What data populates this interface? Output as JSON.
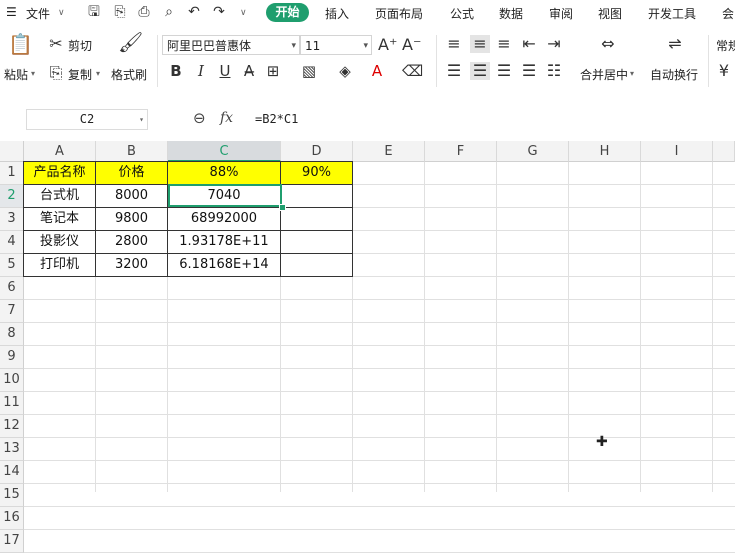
{
  "menubar": {
    "file_label": "文件",
    "tabs": [
      "开始",
      "插入",
      "页面布局",
      "公式",
      "数据",
      "审阅",
      "视图",
      "开发工具",
      "会"
    ],
    "active_tab": "开始",
    "accent_color": "#1f9e6e"
  },
  "ribbon": {
    "paste": "粘贴",
    "cut": "剪切",
    "copy": "复制",
    "format_painter": "格式刷",
    "font_name": "阿里巴巴普惠体",
    "font_size": "11",
    "merge_center": "合并居中",
    "wrap_text": "自动换行",
    "number_format": "常规"
  },
  "formula_bar": {
    "name_box": "C2",
    "fx_label": "fx",
    "formula": "=B2*C1"
  },
  "sheet": {
    "columns": [
      "A",
      "B",
      "C",
      "D",
      "E",
      "F",
      "G",
      "H",
      "I"
    ],
    "rows": [
      "1",
      "2",
      "3",
      "4",
      "5",
      "6",
      "7",
      "8",
      "9",
      "10",
      "11",
      "12",
      "13",
      "14",
      "15",
      "16",
      "17"
    ],
    "selected_column": "C",
    "selected_row": "2",
    "header_row": [
      "产品名称",
      "价格",
      "88%",
      "90%"
    ],
    "data": [
      [
        "台式机",
        "8000",
        "7040",
        ""
      ],
      [
        "笔记本",
        "9800",
        "68992000",
        ""
      ],
      [
        "投影仪",
        "2800",
        "1.93178E+11",
        ""
      ],
      [
        "打印机",
        "3200",
        "6.18168E+14",
        ""
      ]
    ],
    "highlight_color": "#ffff00"
  }
}
